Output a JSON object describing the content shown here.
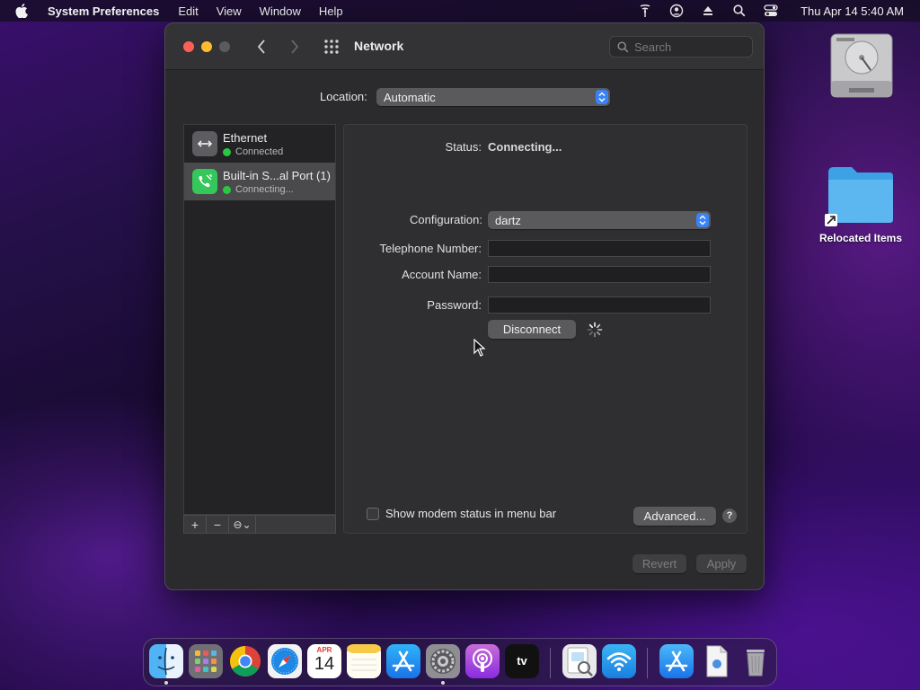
{
  "menubar": {
    "app_name": "System Preferences",
    "menus": [
      "Edit",
      "View",
      "Window",
      "Help"
    ],
    "clock": "Thu Apr 14  5:40 AM",
    "status_icons": [
      "modem-icon",
      "user-account-icon",
      "eject-icon",
      "spotlight-search-icon",
      "control-center-icon"
    ]
  },
  "desktop": {
    "items": [
      {
        "label": "",
        "icon": "hard-drive-icon"
      },
      {
        "label": "Relocated Items",
        "icon": "folder-alias-icon"
      }
    ]
  },
  "window": {
    "title": "Network",
    "search_placeholder": "Search",
    "location_label": "Location:",
    "location_value": "Automatic",
    "services": [
      {
        "name": "Ethernet",
        "status": "Connected",
        "icon": "ethernet-icon",
        "selected": false
      },
      {
        "name": "Built-in S...al Port (1)",
        "status": "Connecting...",
        "icon": "modem-phone-icon",
        "selected": true
      }
    ],
    "list_toolbar": {
      "add": "+",
      "remove": "−",
      "action": "⊖⌄"
    },
    "detail": {
      "status_label": "Status:",
      "status_value": "Connecting...",
      "configuration_label": "Configuration:",
      "configuration_value": "dartz",
      "telephone_label": "Telephone Number:",
      "telephone_value": "",
      "account_label": "Account Name:",
      "account_value": "",
      "password_label": "Password:",
      "password_value": "",
      "disconnect_button": "Disconnect",
      "show_modem_status_label": "Show modem status in menu bar",
      "show_modem_status_checked": false,
      "advanced_button": "Advanced...",
      "help_button": "?"
    },
    "revert_button": "Revert",
    "apply_button": "Apply"
  },
  "dock": {
    "apps": [
      {
        "name": "Finder",
        "icon": "finder-icon",
        "running": true
      },
      {
        "name": "Launchpad",
        "icon": "launchpad-icon",
        "running": false
      },
      {
        "name": "Chrome",
        "icon": "chrome-icon",
        "running": false
      },
      {
        "name": "Safari",
        "icon": "safari-icon",
        "running": false
      },
      {
        "name": "Calendar",
        "icon": "calendar-icon",
        "running": false,
        "month": "APR",
        "day": "14"
      },
      {
        "name": "Notes",
        "icon": "notes-icon",
        "running": false
      },
      {
        "name": "App Store",
        "icon": "app-store-icon",
        "running": false
      },
      {
        "name": "System Preferences",
        "icon": "system-preferences-icon",
        "running": true
      },
      {
        "name": "Podcasts",
        "icon": "podcasts-icon",
        "running": false
      },
      {
        "name": "TV",
        "icon": "apple-tv-icon",
        "running": false,
        "text": "tv"
      },
      {
        "name": "Preview",
        "icon": "preview-icon",
        "running": false
      },
      {
        "name": "Wireless Diagnostics",
        "icon": "wifi-diagnostics-icon",
        "running": false
      },
      {
        "name": "App Store Downloads",
        "icon": "app-store-folder-icon",
        "running": false
      },
      {
        "name": "Document",
        "icon": "document-icon",
        "running": false
      },
      {
        "name": "Trash",
        "icon": "trash-icon",
        "running": false
      }
    ]
  }
}
